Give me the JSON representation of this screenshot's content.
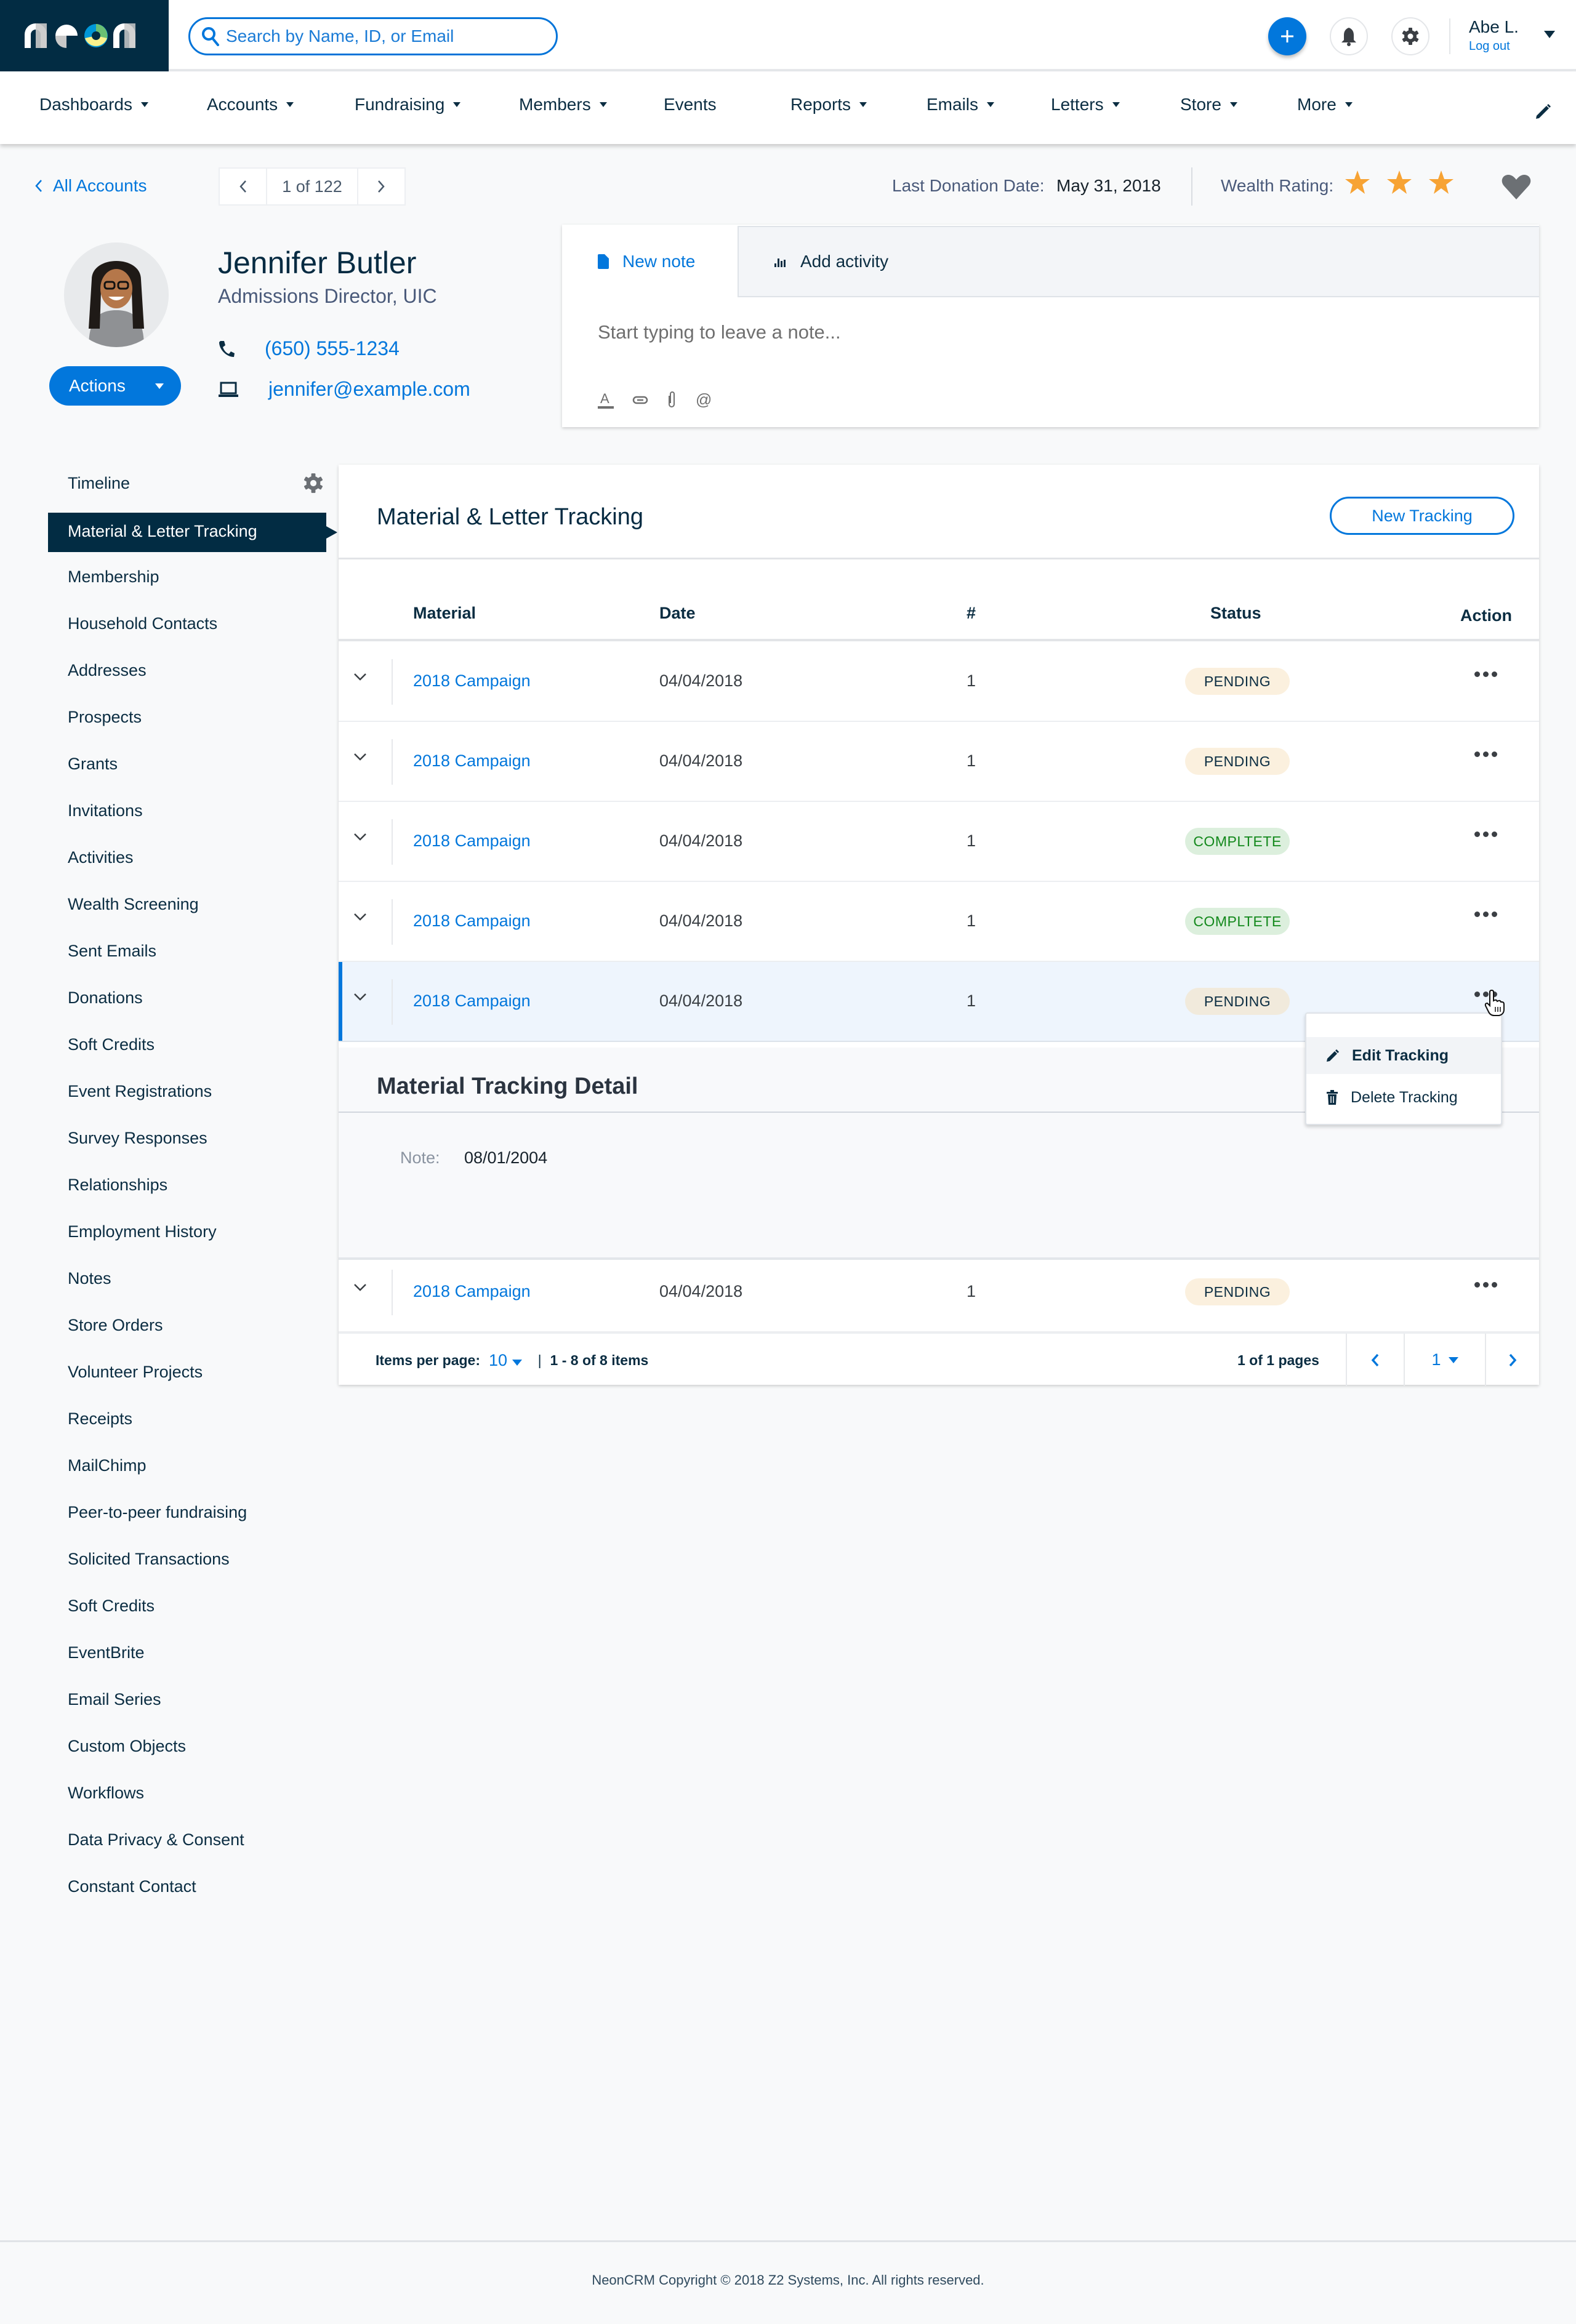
{
  "topbar": {
    "brand": "neon",
    "search_placeholder": "Search by Name, ID, or Email",
    "add_icon": "plus-icon",
    "notifications_icon": "bell-icon",
    "settings_icon": "gear-icon",
    "user_name": "Abe L.",
    "logout_label": "Log out"
  },
  "nav": {
    "items": [
      {
        "label": "Dashboards",
        "has_menu": true
      },
      {
        "label": "Accounts",
        "has_menu": true
      },
      {
        "label": "Fundraising",
        "has_menu": true
      },
      {
        "label": "Members",
        "has_menu": true
      },
      {
        "label": "Events",
        "has_menu": false
      },
      {
        "label": "Reports",
        "has_menu": true
      },
      {
        "label": "Emails",
        "has_menu": true
      },
      {
        "label": "Letters",
        "has_menu": true
      },
      {
        "label": "Store",
        "has_menu": true
      },
      {
        "label": "More",
        "has_menu": true
      }
    ],
    "edit_icon": "pencil-icon"
  },
  "breadcrumb": {
    "back_label": "All Accounts",
    "record_position": "1 of 122"
  },
  "summary": {
    "last_donation_label": "Last Donation Date:",
    "last_donation_value": "May 31, 2018",
    "wealth_rating_label": "Wealth Rating:",
    "wealth_rating_stars": 3,
    "favorite_icon": "heart-icon",
    "star_color": "#f7a334"
  },
  "profile": {
    "name": "Jennifer Butler",
    "title": "Admissions Director, UIC",
    "phone": "(650) 555-1234",
    "email": "jennifer@example.com",
    "actions_label": "Actions"
  },
  "note_card": {
    "tabs": [
      {
        "label": "New note",
        "icon": "document-icon",
        "active": true
      },
      {
        "label": "Add activity",
        "icon": "bar-chart-icon",
        "active": false
      }
    ],
    "placeholder": "Start typing to leave a note...",
    "tools": [
      "text-color-icon",
      "link-icon",
      "paperclip-icon",
      "mention-icon"
    ]
  },
  "sidebar": {
    "items": [
      {
        "label": "Timeline"
      },
      {
        "label": "Material & Letter Tracking",
        "active": true
      },
      {
        "label": "Membership"
      },
      {
        "label": "Household Contacts"
      },
      {
        "label": "Addresses"
      },
      {
        "label": "Prospects"
      },
      {
        "label": "Grants"
      },
      {
        "label": "Invitations"
      },
      {
        "label": "Activities"
      },
      {
        "label": "Wealth Screening"
      },
      {
        "label": "Sent Emails"
      },
      {
        "label": "Donations"
      },
      {
        "label": "Soft Credits"
      },
      {
        "label": "Event Registrations"
      },
      {
        "label": "Survey Responses"
      },
      {
        "label": "Relationships"
      },
      {
        "label": "Employment History"
      },
      {
        "label": "Notes"
      },
      {
        "label": "Store Orders"
      },
      {
        "label": "Volunteer Projects"
      },
      {
        "label": "Receipts"
      },
      {
        "label": "MailChimp"
      },
      {
        "label": "Peer-to-peer fundraising"
      },
      {
        "label": "Solicited Transactions"
      },
      {
        "label": "Soft Credits"
      },
      {
        "label": "EventBrite"
      },
      {
        "label": "Email Series"
      },
      {
        "label": "Custom Objects"
      },
      {
        "label": "Workflows"
      },
      {
        "label": "Data Privacy & Consent"
      },
      {
        "label": "Constant Contact"
      }
    ]
  },
  "tracking": {
    "title": "Material & Letter Tracking",
    "new_button": "New Tracking",
    "columns": {
      "material": "Material",
      "date": "Date",
      "count": "#",
      "status": "Status",
      "action": "Action"
    },
    "rows": [
      {
        "material": "2018 Campaign",
        "date": "04/04/2018",
        "count": "1",
        "status": "PENDING",
        "status_type": "pending"
      },
      {
        "material": "2018 Campaign",
        "date": "04/04/2018",
        "count": "1",
        "status": "PENDING",
        "status_type": "pending"
      },
      {
        "material": "2018 Campaign",
        "date": "04/04/2018",
        "count": "1",
        "status": "COMPLTETE",
        "status_type": "complete"
      },
      {
        "material": "2018 Campaign",
        "date": "04/04/2018",
        "count": "1",
        "status": "COMPLTETE",
        "status_type": "complete"
      },
      {
        "material": "2018 Campaign",
        "date": "04/04/2018",
        "count": "1",
        "status": "PENDING",
        "status_type": "pending",
        "selected": true
      },
      {
        "material": "2018 Campaign",
        "date": "04/04/2018",
        "count": "1",
        "status": "PENDING",
        "status_type": "pending"
      }
    ],
    "detail": {
      "title": "Material Tracking Detail",
      "note_label": "Note:",
      "note_value": "08/01/2004"
    },
    "row_menu": {
      "items": [
        {
          "label": "Edit Tracking",
          "icon": "pencil-icon"
        },
        {
          "label": "Delete Tracking",
          "icon": "trash-icon"
        }
      ]
    },
    "pagination": {
      "items_per_page_label": "Items per page:",
      "items_per_page": "10",
      "range": "1 - 8 of 8 items",
      "pages_label": "1 of 1 pages",
      "current_page": "1"
    }
  },
  "footer": {
    "copyright": "NeonCRM Copyright © 2018 Z2 Systems, Inc. All rights reserved."
  }
}
